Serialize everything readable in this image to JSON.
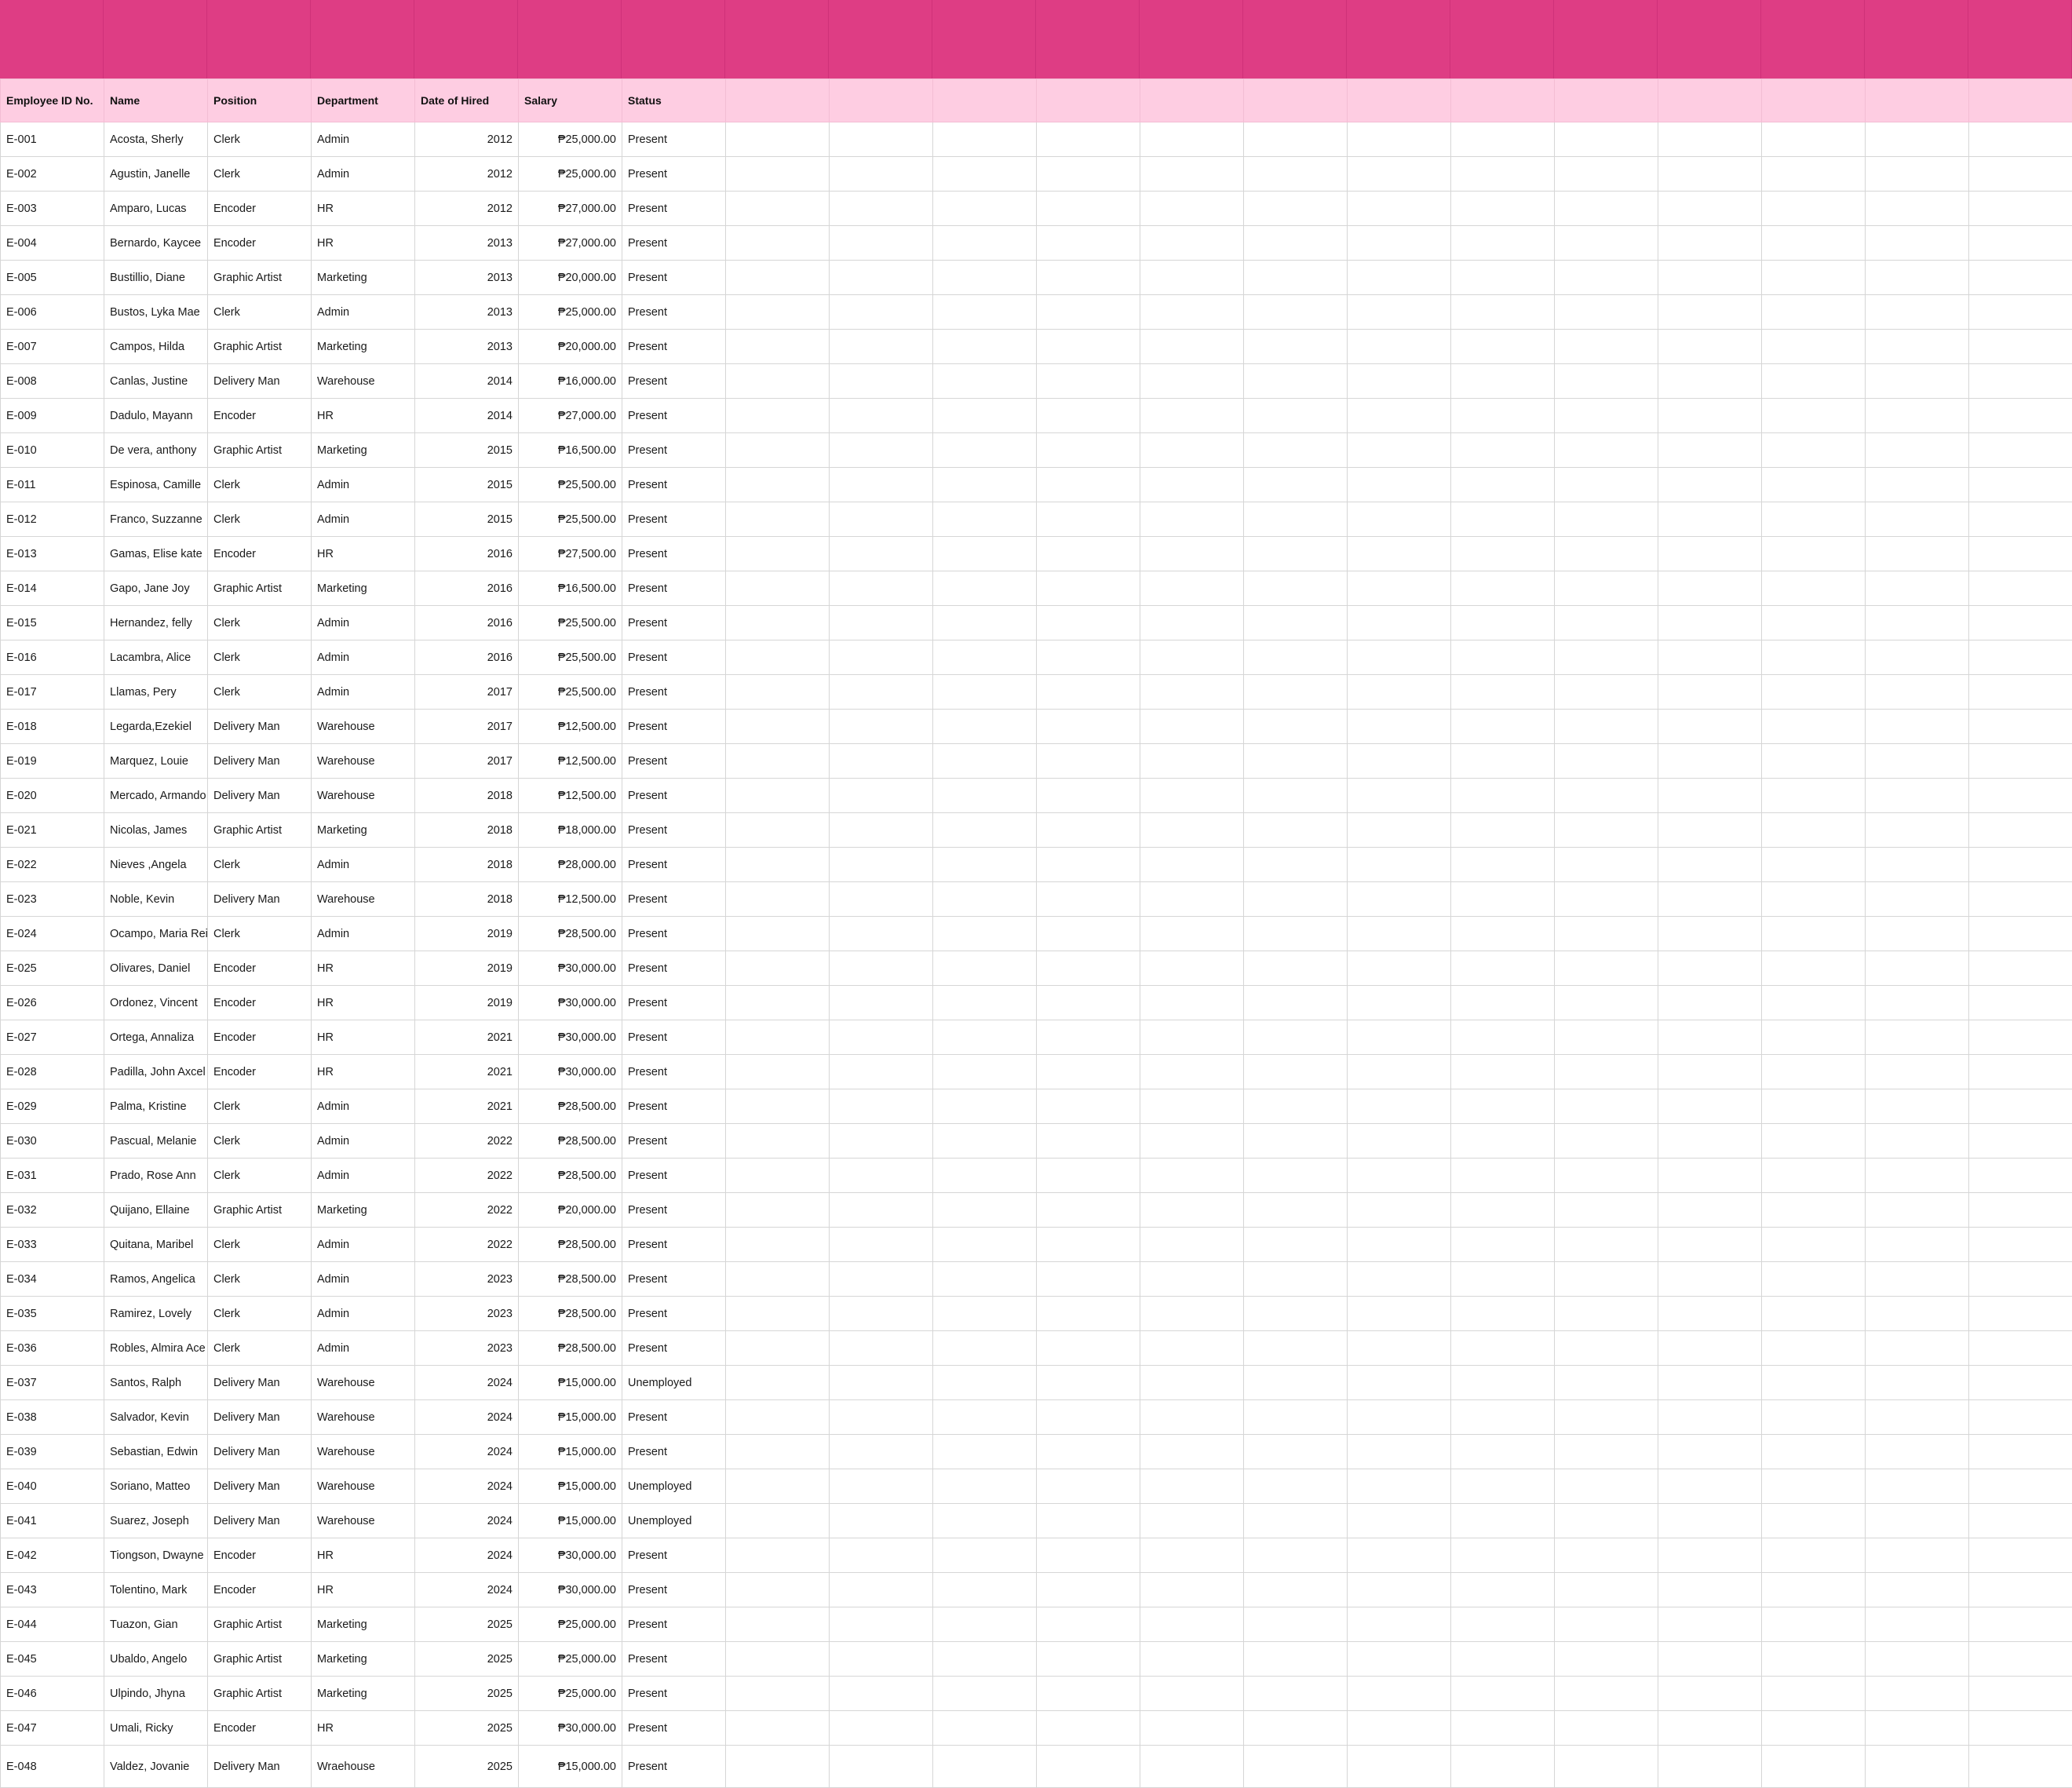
{
  "theme": {
    "banner_color": "#de3d84",
    "header_color": "#fecde2",
    "grid_color": "#d6d6d6"
  },
  "table": {
    "headers": [
      "Employee ID No.",
      "Name",
      "Position",
      "Department",
      "Date of Hired",
      "Salary",
      "Status"
    ],
    "rows": [
      [
        "E-001",
        "Acosta, Sherly",
        "Clerk",
        "Admin",
        "2012",
        "₱25,000.00",
        "Present"
      ],
      [
        "E-002",
        "Agustin, Janelle",
        "Clerk",
        "Admin",
        "2012",
        "₱25,000.00",
        "Present"
      ],
      [
        "E-003",
        "Amparo, Lucas",
        "Encoder",
        "HR",
        "2012",
        "₱27,000.00",
        "Present"
      ],
      [
        "E-004",
        "Bernardo, Kaycee",
        "Encoder",
        "HR",
        "2013",
        "₱27,000.00",
        "Present"
      ],
      [
        "E-005",
        "Bustillio, Diane",
        "Graphic Artist",
        "Marketing",
        "2013",
        "₱20,000.00",
        "Present"
      ],
      [
        "E-006",
        "Bustos, Lyka Mae",
        "Clerk",
        "Admin",
        "2013",
        "₱25,000.00",
        "Present"
      ],
      [
        "E-007",
        "Campos, Hilda",
        "Graphic Artist",
        "Marketing",
        "2013",
        "₱20,000.00",
        "Present"
      ],
      [
        "E-008",
        "Canlas, Justine",
        "Delivery Man",
        "Warehouse",
        "2014",
        "₱16,000.00",
        "Present"
      ],
      [
        "E-009",
        "Dadulo, Mayann",
        "Encoder",
        "HR",
        "2014",
        "₱27,000.00",
        "Present"
      ],
      [
        "E-010",
        "De vera, anthony",
        "Graphic Artist",
        "Marketing",
        "2015",
        "₱16,500.00",
        "Present"
      ],
      [
        "E-011",
        "Espinosa, Camille",
        "Clerk",
        "Admin",
        "2015",
        "₱25,500.00",
        "Present"
      ],
      [
        "E-012",
        "Franco, Suzzanne",
        "Clerk",
        "Admin",
        "2015",
        "₱25,500.00",
        "Present"
      ],
      [
        "E-013",
        "Gamas, Elise kate",
        "Encoder",
        "HR",
        "2016",
        "₱27,500.00",
        "Present"
      ],
      [
        "E-014",
        "Gapo, Jane Joy",
        "Graphic Artist",
        "Marketing",
        "2016",
        "₱16,500.00",
        "Present"
      ],
      [
        "E-015",
        "Hernandez, felly",
        "Clerk",
        "Admin",
        "2016",
        "₱25,500.00",
        "Present"
      ],
      [
        "E-016",
        "Lacambra, Alice",
        "Clerk",
        "Admin",
        "2016",
        "₱25,500.00",
        "Present"
      ],
      [
        "E-017",
        "Llamas, Pery",
        "Clerk",
        "Admin",
        "2017",
        "₱25,500.00",
        "Present"
      ],
      [
        "E-018",
        "Legarda,Ezekiel",
        "Delivery Man",
        "Warehouse",
        "2017",
        "₱12,500.00",
        "Present"
      ],
      [
        "E-019",
        "Marquez, Louie",
        "Delivery Man",
        "Warehouse",
        "2017",
        "₱12,500.00",
        "Present"
      ],
      [
        "E-020",
        "Mercado, Armando",
        "Delivery Man",
        "Warehouse",
        "2018",
        "₱12,500.00",
        "Present"
      ],
      [
        "E-021",
        "Nicolas, James",
        "Graphic Artist",
        "Marketing",
        "2018",
        "₱18,000.00",
        "Present"
      ],
      [
        "E-022",
        "Nieves ,Angela",
        "Clerk",
        "Admin",
        "2018",
        "₱28,000.00",
        "Present"
      ],
      [
        "E-023",
        "Noble, Kevin",
        "Delivery Man",
        "Warehouse",
        "2018",
        "₱12,500.00",
        "Present"
      ],
      [
        "E-024",
        "Ocampo, Maria Rei",
        "Clerk",
        "Admin",
        "2019",
        "₱28,500.00",
        "Present"
      ],
      [
        "E-025",
        "Olivares, Daniel",
        "Encoder",
        "HR",
        "2019",
        "₱30,000.00",
        "Present"
      ],
      [
        "E-026",
        "Ordonez, Vincent",
        "Encoder",
        "HR",
        "2019",
        "₱30,000.00",
        "Present"
      ],
      [
        "E-027",
        "Ortega, Annaliza",
        "Encoder",
        "HR",
        "2021",
        "₱30,000.00",
        "Present"
      ],
      [
        "E-028",
        "Padilla, John Axcel",
        "Encoder",
        "HR",
        "2021",
        "₱30,000.00",
        "Present"
      ],
      [
        "E-029",
        "Palma, Kristine",
        "Clerk",
        "Admin",
        "2021",
        "₱28,500.00",
        "Present"
      ],
      [
        "E-030",
        "Pascual, Melanie",
        "Clerk",
        "Admin",
        "2022",
        "₱28,500.00",
        "Present"
      ],
      [
        "E-031",
        "Prado, Rose Ann",
        "Clerk",
        "Admin",
        "2022",
        "₱28,500.00",
        "Present"
      ],
      [
        "E-032",
        "Quijano, Ellaine",
        "Graphic Artist",
        "Marketing",
        "2022",
        "₱20,000.00",
        "Present"
      ],
      [
        "E-033",
        "Quitana, Maribel",
        "Clerk",
        "Admin",
        "2022",
        "₱28,500.00",
        "Present"
      ],
      [
        "E-034",
        "Ramos, Angelica",
        "Clerk",
        "Admin",
        "2023",
        "₱28,500.00",
        "Present"
      ],
      [
        "E-035",
        "Ramirez, Lovely",
        "Clerk",
        "Admin",
        "2023",
        "₱28,500.00",
        "Present"
      ],
      [
        "E-036",
        "Robles, Almira Ace",
        "Clerk",
        "Admin",
        "2023",
        "₱28,500.00",
        "Present"
      ],
      [
        "E-037",
        "Santos, Ralph",
        "Delivery Man",
        "Warehouse",
        "2024",
        "₱15,000.00",
        "Unemployed"
      ],
      [
        "E-038",
        "Salvador, Kevin",
        "Delivery Man",
        "Warehouse",
        "2024",
        "₱15,000.00",
        "Present"
      ],
      [
        "E-039",
        "Sebastian, Edwin",
        "Delivery Man",
        "Warehouse",
        "2024",
        "₱15,000.00",
        "Present"
      ],
      [
        "E-040",
        "Soriano, Matteo",
        "Delivery Man",
        "Warehouse",
        "2024",
        "₱15,000.00",
        "Unemployed"
      ],
      [
        "E-041",
        "Suarez, Joseph",
        "Delivery Man",
        "Warehouse",
        "2024",
        "₱15,000.00",
        "Unemployed"
      ],
      [
        "E-042",
        "Tiongson, Dwayne",
        "Encoder",
        "HR",
        "2024",
        "₱30,000.00",
        "Present"
      ],
      [
        "E-043",
        "Tolentino, Mark",
        "Encoder",
        "HR",
        "2024",
        "₱30,000.00",
        "Present"
      ],
      [
        "E-044",
        "Tuazon, Gian",
        "Graphic Artist",
        "Marketing",
        "2025",
        "₱25,000.00",
        "Present"
      ],
      [
        "E-045",
        "Ubaldo, Angelo",
        "Graphic Artist",
        "Marketing",
        "2025",
        "₱25,000.00",
        "Present"
      ],
      [
        "E-046",
        "Ulpindo, Jhyna",
        "Graphic Artist",
        "Marketing",
        "2025",
        "₱25,000.00",
        "Present"
      ],
      [
        "E-047",
        "Umali, Ricky",
        "Encoder",
        "HR",
        "2025",
        "₱30,000.00",
        "Present"
      ],
      [
        "E-048",
        "Valdez, Jovanie",
        "Delivery Man",
        "Wraehouse",
        "2025",
        "₱15,000.00",
        "Present"
      ]
    ]
  }
}
